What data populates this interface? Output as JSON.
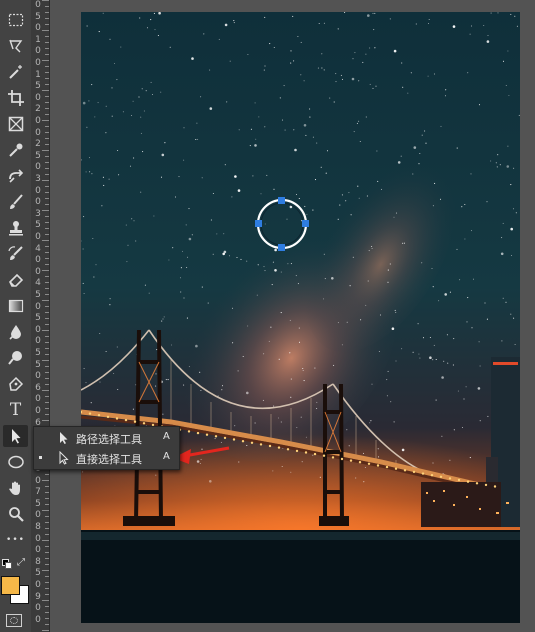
{
  "toolbar": {
    "tools": [
      {
        "name": "marquee-tool",
        "icon": "rect-marquee-icon"
      },
      {
        "name": "lasso-tool",
        "icon": "lasso-icon"
      },
      {
        "name": "magic-wand-tool",
        "icon": "magic-wand-icon"
      },
      {
        "name": "crop-tool",
        "icon": "crop-icon"
      },
      {
        "name": "frame-tool",
        "icon": "frame-icon"
      },
      {
        "name": "eyedropper-tool",
        "icon": "eyedropper-icon"
      },
      {
        "name": "healing-brush-tool",
        "icon": "bandage-icon"
      },
      {
        "name": "brush-tool",
        "icon": "brush-icon"
      },
      {
        "name": "clone-stamp-tool",
        "icon": "stamp-icon"
      },
      {
        "name": "history-brush-tool",
        "icon": "history-brush-icon"
      },
      {
        "name": "eraser-tool",
        "icon": "eraser-icon"
      },
      {
        "name": "gradient-tool",
        "icon": "gradient-icon"
      },
      {
        "name": "blur-tool",
        "icon": "blur-drop-icon"
      },
      {
        "name": "dodge-tool",
        "icon": "dodge-icon"
      },
      {
        "name": "pen-tool",
        "icon": "pen-icon"
      },
      {
        "name": "type-tool",
        "icon": "type-icon"
      },
      {
        "name": "path-selection-tool",
        "icon": "arrow-cursor-icon"
      },
      {
        "name": "ellipse-tool",
        "icon": "ellipse-icon"
      },
      {
        "name": "hand-tool",
        "icon": "hand-icon"
      },
      {
        "name": "zoom-tool",
        "icon": "magnifier-icon"
      },
      {
        "name": "more-tools",
        "icon": "ellipsis-icon"
      }
    ],
    "type_glyph": "T",
    "more_glyph": "•••",
    "foreground_color": "#f6b848",
    "background_color": "#ffffff"
  },
  "ruler": {
    "labels": [
      "0",
      "5",
      "0",
      "1",
      "0",
      "0",
      "1",
      "5",
      "0",
      "2",
      "0",
      "0",
      "2",
      "5",
      "0",
      "3",
      "0",
      "0",
      "3",
      "5",
      "0",
      "4",
      "0",
      "0",
      "4",
      "5",
      "0",
      "5",
      "0",
      "0",
      "5",
      "5",
      "0",
      "6",
      "0",
      "0",
      "6",
      "5",
      "0",
      "7",
      "0",
      "0",
      "7",
      "5",
      "0",
      "8",
      "0",
      "0",
      "8",
      "5",
      "0",
      "9",
      "0",
      "0"
    ]
  },
  "flyout": {
    "items": [
      {
        "label": "路径选择工具",
        "shortcut": "A",
        "icon": "arrow-cursor-icon",
        "selected": false
      },
      {
        "label": "直接选择工具",
        "shortcut": "A",
        "icon": "hollow-arrow-cursor-icon",
        "selected": true
      }
    ]
  },
  "canvas": {
    "description_icon": "night-bridge-photo",
    "accent": "#2f7de1",
    "arrow_color": "#e3261e"
  }
}
